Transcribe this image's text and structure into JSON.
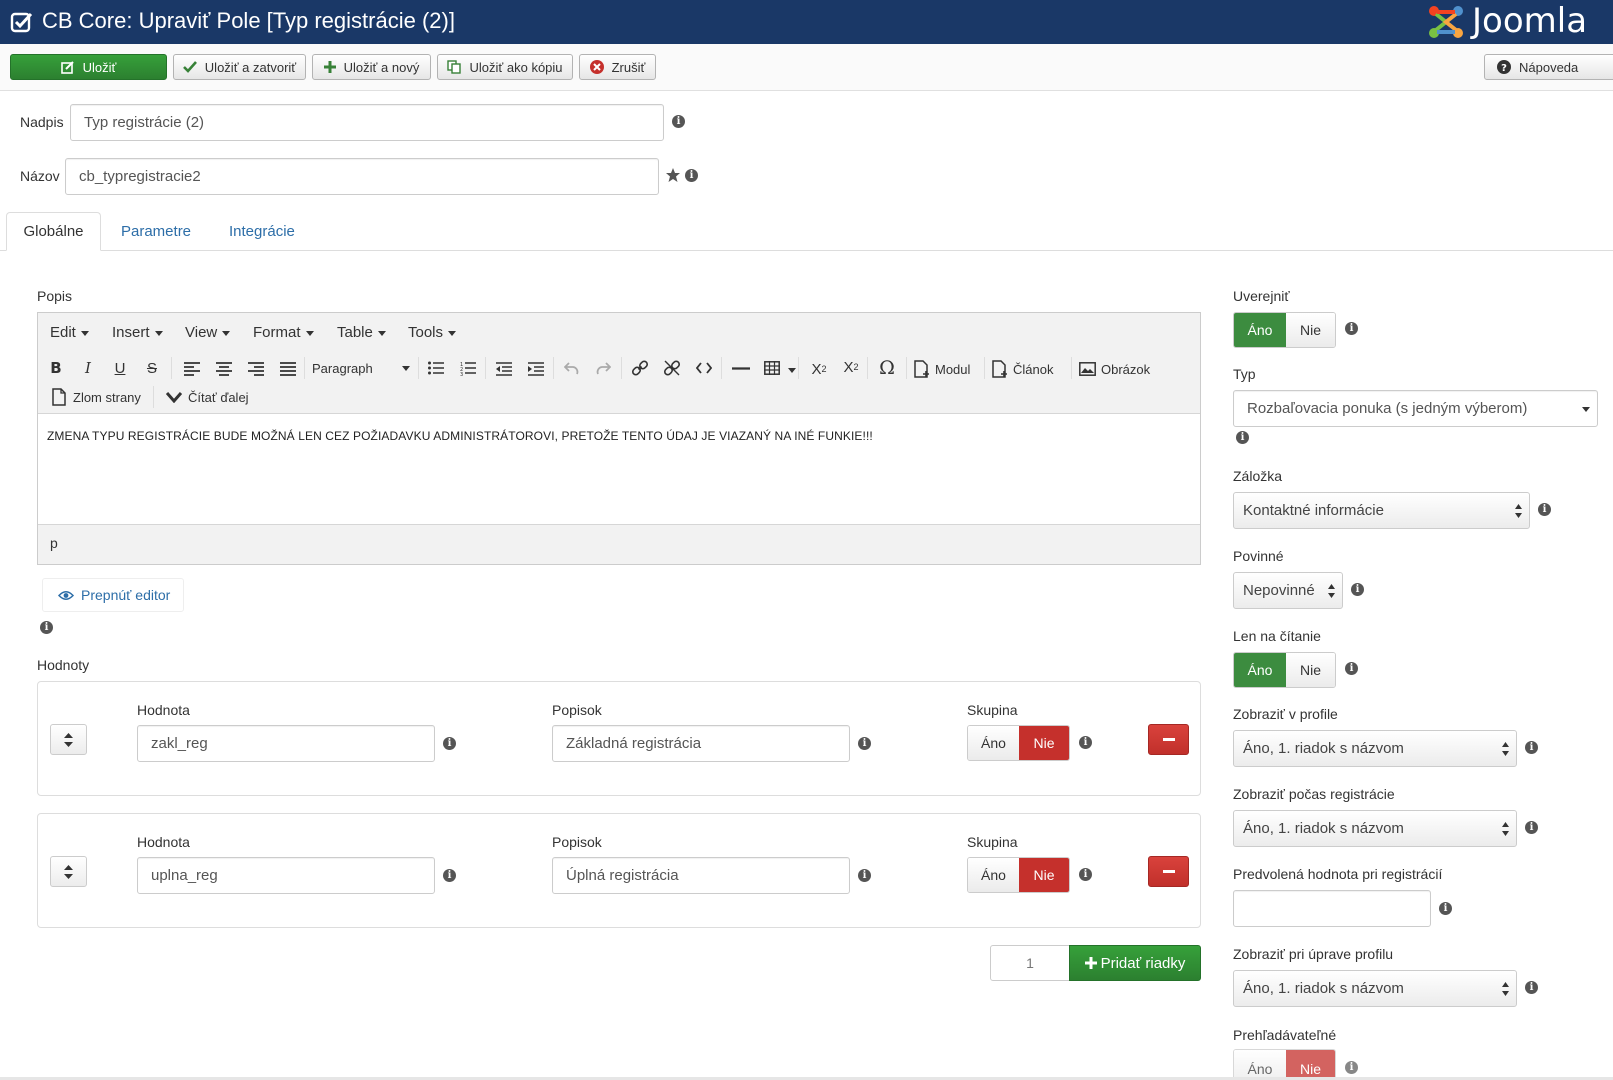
{
  "header": {
    "title": "CB Core: Upraviť Pole [Typ registrácie (2)]",
    "logo_text": "Joomla"
  },
  "toolbar": {
    "save": "Uložiť",
    "save_close": "Uložiť a zatvoriť",
    "save_new": "Uložiť a nový",
    "save_copy": "Uložiť ako kópiu",
    "cancel": "Zrušiť",
    "help": "Nápoveda"
  },
  "fields": {
    "title_label": "Nadpis",
    "title_value": "Typ registrácie (2)",
    "name_label": "Názov",
    "name_value": "cb_typregistracie2"
  },
  "tabs": [
    "Globálne",
    "Parametre",
    "Integrácie"
  ],
  "editor": {
    "section_label": "Popis",
    "menu": [
      "Edit",
      "Insert",
      "View",
      "Format",
      "Table",
      "Tools"
    ],
    "format_select": "Paragraph",
    "buttons": {
      "module": "Modul",
      "article": "Článok",
      "image": "Obrázok",
      "pagebreak": "Zlom strany",
      "readmore": "Čítať ďalej"
    },
    "content": "ZMENA TYPU REGISTRÁCIE BUDE MOŽNÁ LEN CEZ POŽIADAVKU ADMINISTRÁTOROVI, PRETOŽE TENTO ÚDAJ JE VIAZANÝ NA INÉ FUNKIE!!!",
    "path": "p",
    "toggle": "Prepnúť editor"
  },
  "values": {
    "section_label": "Hodnoty",
    "value_label": "Hodnota",
    "caption_label": "Popisok",
    "group_label": "Skupina",
    "yes": "Áno",
    "no": "Nie",
    "rows": [
      {
        "value": "zakl_reg",
        "caption": "Základná registrácia"
      },
      {
        "value": "uplna_reg",
        "caption": "Úplná registrácia"
      }
    ],
    "add_count": "1",
    "add_button": "Pridať riadky"
  },
  "right": {
    "publish_label": "Uverejniť",
    "type_label": "Typ",
    "type_value": "Rozbaľovacia ponuka (s jedným výberom)",
    "tab_label": "Záložka",
    "tab_value": "Kontaktné informácie",
    "required_label": "Povinné",
    "required_value": "Nepovinné",
    "readonly_label": "Len na čítanie",
    "profile_label": "Zobraziť v profile",
    "profile_value": "Áno, 1. riadok s názvom",
    "registration_label": "Zobraziť počas registrácie",
    "registration_value": "Áno, 1. riadok s názvom",
    "default_label": "Predvolená hodnota pri registrácií",
    "edit_label": "Zobraziť pri úprave profilu",
    "edit_value": "Áno, 1. riadok s názvom",
    "searchable_label": "Prehľadávateľné"
  },
  "colors": {
    "header_bg": "#1a3867",
    "success": "#3c8c3f",
    "danger": "#c5302c",
    "link": "#2d6ea8"
  }
}
